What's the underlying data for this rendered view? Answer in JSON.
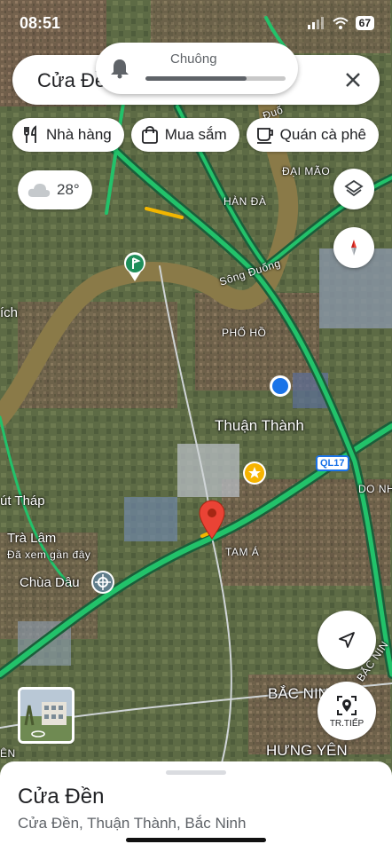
{
  "status": {
    "time": "08:51",
    "battery": "67"
  },
  "notification": {
    "label": "Chuông",
    "progress": 0.72
  },
  "search": {
    "query": "Cửa Đền"
  },
  "chips": [
    {
      "label": "Nhà hàng",
      "icon": "fork-knife-icon"
    },
    {
      "label": "Mua sắm",
      "icon": "shopping-bag-icon"
    },
    {
      "label": "Quán cà phê",
      "icon": "coffee-cup-icon"
    }
  ],
  "weather": {
    "temp": "28°",
    "icon": "cloud-icon"
  },
  "map_labels": {
    "dai_mao": "ĐẠI MÃO",
    "han_da": "HÀN ĐÀ",
    "song_duong": "Sông Đuống",
    "pho_ho": "PHỐ HỒ",
    "thuan_thanh": "Thuận Thành",
    "ql17": "QL17",
    "do_nh": "DO NH",
    "ut_thap": "út Tháp",
    "tra_lam": "Trà Lâm",
    "da_xem": "Đã xem gần đây",
    "tam_a": "TAM Á",
    "chua_dau": "Chùa Dâu",
    "bac_ninh": "BẮC NINH",
    "bac_nin_road": "BẮC NIN",
    "hung_yen": "HƯNG YÊN",
    "ich": "ích",
    "en": "ÊN",
    "duo": "Đuố"
  },
  "next_button": {
    "label": "TR.TIẾP"
  },
  "place": {
    "title": "Cửa Đền",
    "subtitle": "Cửa Đền, Thuận Thành, Bắc Ninh"
  },
  "colors": {
    "traffic_green": "#22c26a",
    "pin_red": "#ea4335",
    "location_blue": "#1a73e8",
    "star_gold": "#f6b400"
  }
}
